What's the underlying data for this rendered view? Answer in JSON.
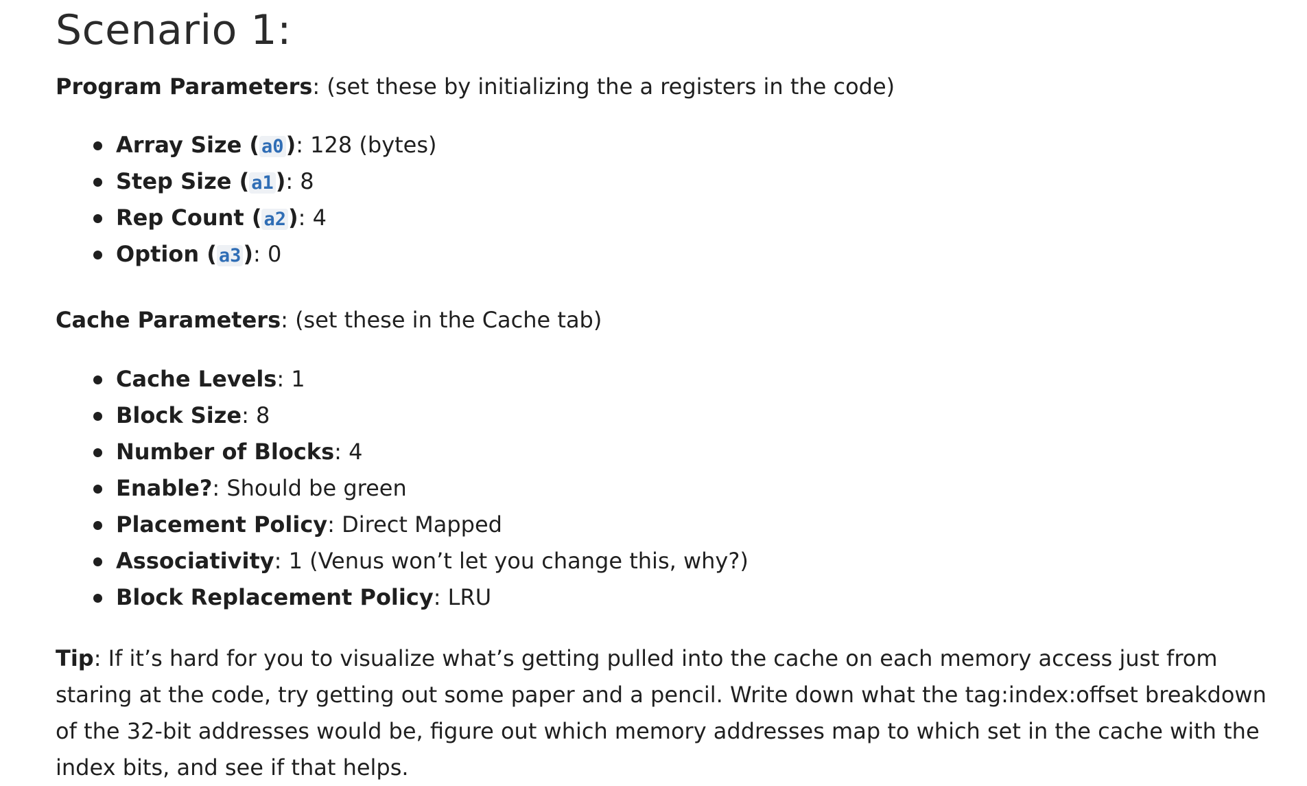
{
  "heading": "Scenario 1:",
  "program": {
    "label": "Program Parameters",
    "note": ": (set these by initializing the a registers in the code)",
    "items": [
      {
        "name": "Array Size",
        "reg": "a0",
        "value": ": 128 (bytes)"
      },
      {
        "name": "Step Size",
        "reg": "a1",
        "value": ": 8"
      },
      {
        "name": "Rep Count",
        "reg": "a2",
        "value": ": 4"
      },
      {
        "name": "Option",
        "reg": "a3",
        "value": ": 0"
      }
    ]
  },
  "cache": {
    "label": "Cache Parameters",
    "note": ": (set these in the Cache tab)",
    "items": [
      {
        "name": "Cache Levels",
        "value": ": 1"
      },
      {
        "name": "Block Size",
        "value": ": 8"
      },
      {
        "name": "Number of Blocks",
        "value": ": 4"
      },
      {
        "name": "Enable?",
        "value": ": Should be green"
      },
      {
        "name": "Placement Policy",
        "value": ": Direct Mapped"
      },
      {
        "name": "Associativity",
        "value": ": 1 (Venus won’t let you change this, why?)"
      },
      {
        "name": "Block Replacement Policy",
        "value": ": LRU"
      }
    ]
  },
  "tip": {
    "label": "Tip",
    "text": ": If it’s hard for you to visualize what’s getting pulled into the cache on each memory access just from staring at the code, try getting out some paper and a pencil. Write down what the tag:index:offset breakdown of the 32-bit addresses would be, figure out which memory addresses map to which set in the cache with the index bits, and see if that helps."
  }
}
